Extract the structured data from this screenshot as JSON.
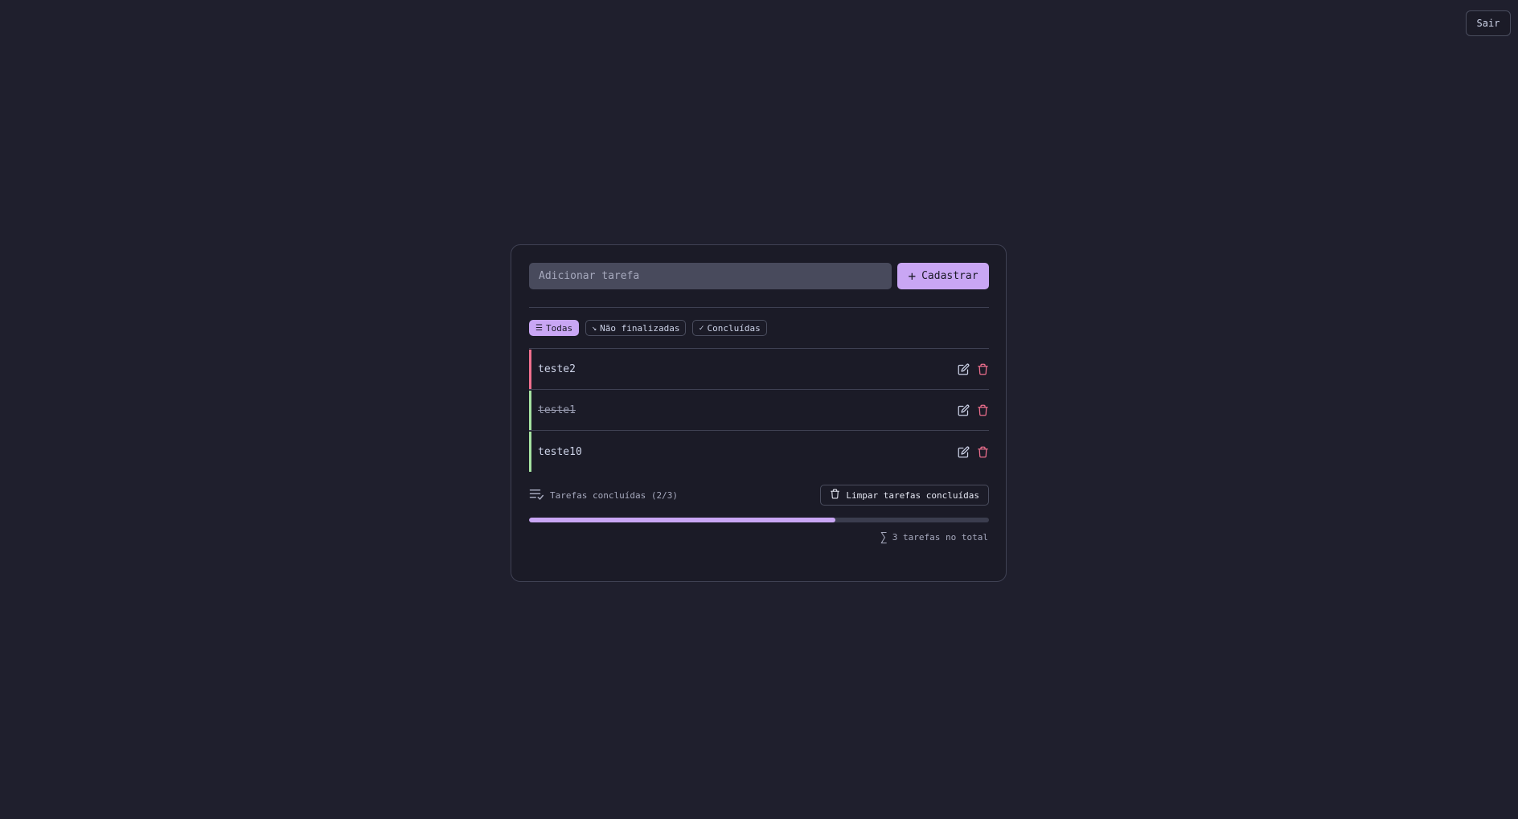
{
  "header": {
    "logout_label": "Sair"
  },
  "add_task": {
    "placeholder": "Adicionar tarefa",
    "value": "",
    "submit_label": "Cadastrar",
    "submit_icon": "plus-icon"
  },
  "filters": [
    {
      "label": "Todas",
      "icon": "list-icon",
      "active": true
    },
    {
      "label": "Não finalizadas",
      "icon": "arrow-down-right-icon",
      "active": false
    },
    {
      "label": "Concluídas",
      "icon": "check-icon",
      "active": false
    }
  ],
  "tasks": [
    {
      "name": "teste2",
      "done": false,
      "status_color": "#f0708e"
    },
    {
      "name": "teste1",
      "done": true,
      "status_color": "#a6e3a1"
    },
    {
      "name": "teste10",
      "done": true,
      "status_color": "#a6e3a1"
    }
  ],
  "footer": {
    "completed_text": "Tarefas concluídas (2/3)",
    "clear_label": "Limpar tarefas concluídas",
    "progress_fraction": 0.6667,
    "total_text": "3 tarefas no total"
  },
  "colors": {
    "background": "#1f1f2d",
    "card": "#1b1b27",
    "accent": "#c9a6f4",
    "danger": "#f0708e",
    "success": "#a6e3a1"
  }
}
